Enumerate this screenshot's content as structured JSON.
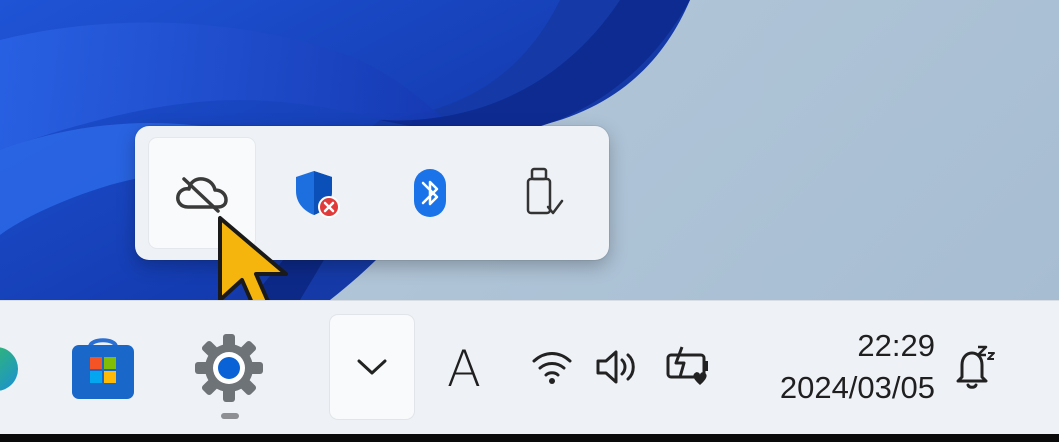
{
  "flyout": {
    "items": [
      {
        "name": "OneDrive",
        "icon": "cloud-offline-icon"
      },
      {
        "name": "Windows Security",
        "icon": "shield-error-icon"
      },
      {
        "name": "Bluetooth",
        "icon": "bluetooth-icon"
      },
      {
        "name": "Safely Remove Hardware",
        "icon": "usb-eject-icon"
      }
    ]
  },
  "taskbar": {
    "apps": [
      {
        "name": "Edge",
        "icon": "edge-icon"
      },
      {
        "name": "Microsoft Store",
        "icon": "store-icon"
      },
      {
        "name": "Settings",
        "icon": "gear-icon"
      }
    ],
    "overflow_icon": "chevron-down-icon",
    "ime_label": "A",
    "status_icons": [
      "wifi-icon",
      "volume-icon",
      "battery-saver-icon"
    ],
    "clock": {
      "time": "22:29",
      "date": "2024/03/05"
    },
    "notification_icon": "bell-snooze-icon"
  },
  "colors": {
    "accent": "#0067c0",
    "wallpaper_blue": "#1a3fbf",
    "cursor": "#f5b50c",
    "error_red": "#e03a3a",
    "bluetooth_blue": "#1a73e8"
  }
}
